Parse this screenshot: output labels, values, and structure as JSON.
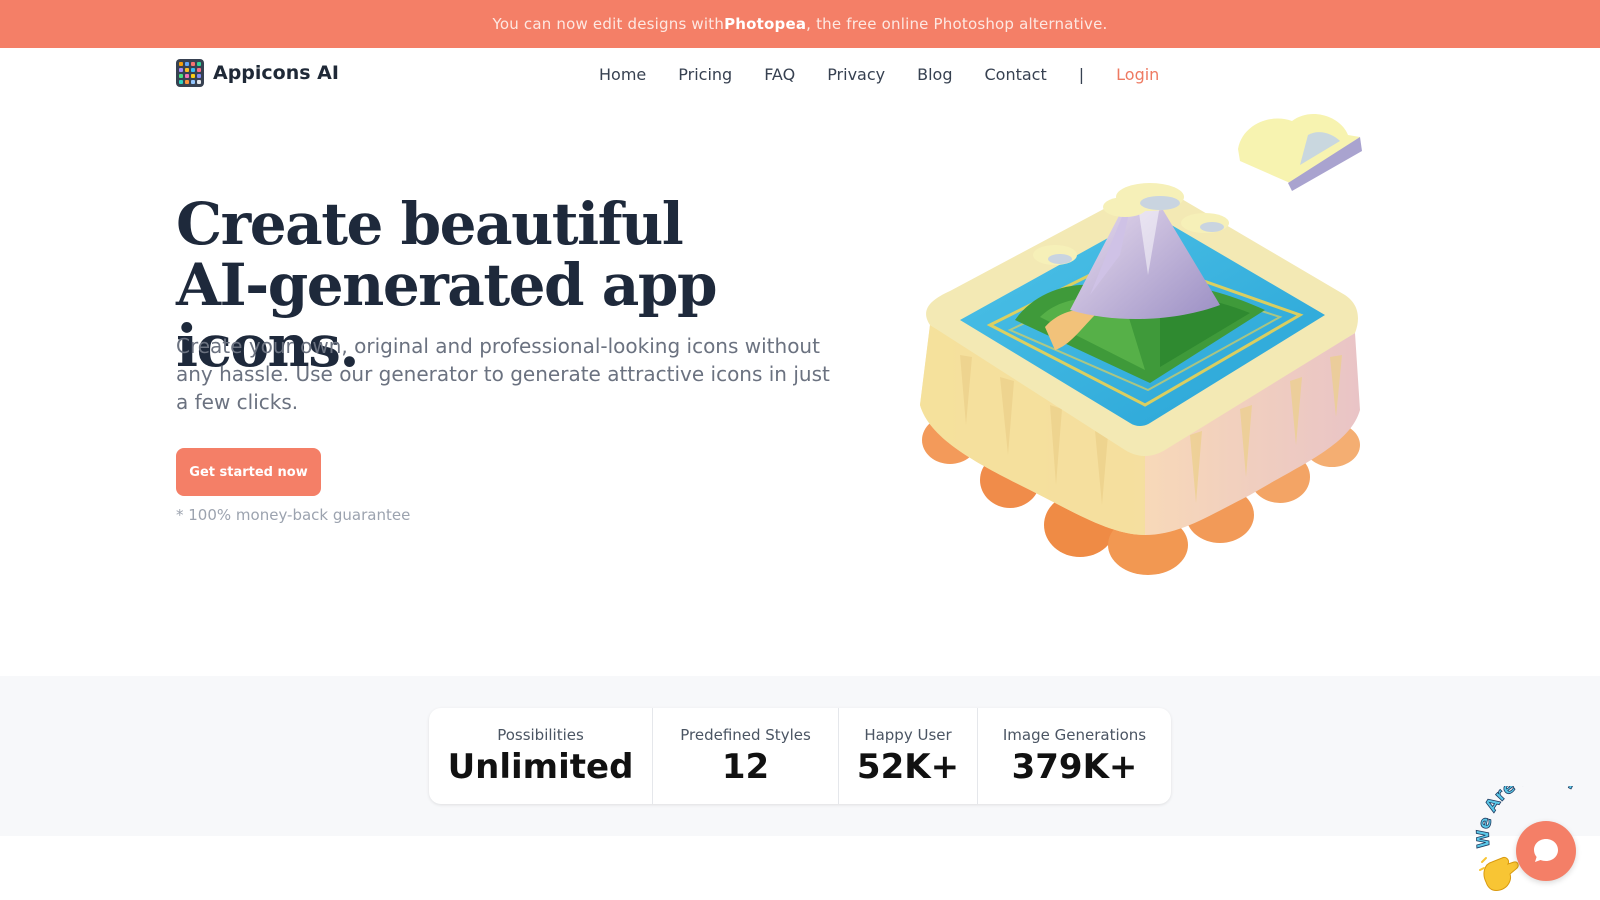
{
  "banner": {
    "prefix": "You can now edit designs with ",
    "link": "Photopea",
    "suffix": ", the free online Photoshop alternative."
  },
  "brand": {
    "name": "Appicons AI",
    "logo_icon": "app-grid-icon"
  },
  "nav": {
    "items": [
      "Home",
      "Pricing",
      "FAQ",
      "Privacy",
      "Blog",
      "Contact"
    ],
    "separator": "|",
    "login": "Login"
  },
  "hero": {
    "title_line1": "Create beautiful",
    "title_line2": "AI-generated app icons.",
    "subtitle": "Create your own, original and professional-looking icons without any hassle. Use our generator to generate attractive icons in just a few clicks.",
    "cta": "Get started now",
    "guarantee": "* 100% money-back guarantee",
    "illustration": "floating-island-illustration"
  },
  "stats": [
    {
      "label": "Possibilities",
      "value": "Unlimited"
    },
    {
      "label": "Predefined Styles",
      "value": "12"
    },
    {
      "label": "Happy User",
      "value": "52K+"
    },
    {
      "label": "Image Generations",
      "value": "379K+"
    }
  ],
  "chat_widget": {
    "badge_text": "We Are Here!",
    "wave_icon": "waving-hand-icon",
    "chat_icon": "chat-bubble-icon"
  },
  "colors": {
    "accent": "#f47f67",
    "heading": "#1e293b",
    "muted": "#6b7280",
    "band": "#f7f8fa"
  }
}
